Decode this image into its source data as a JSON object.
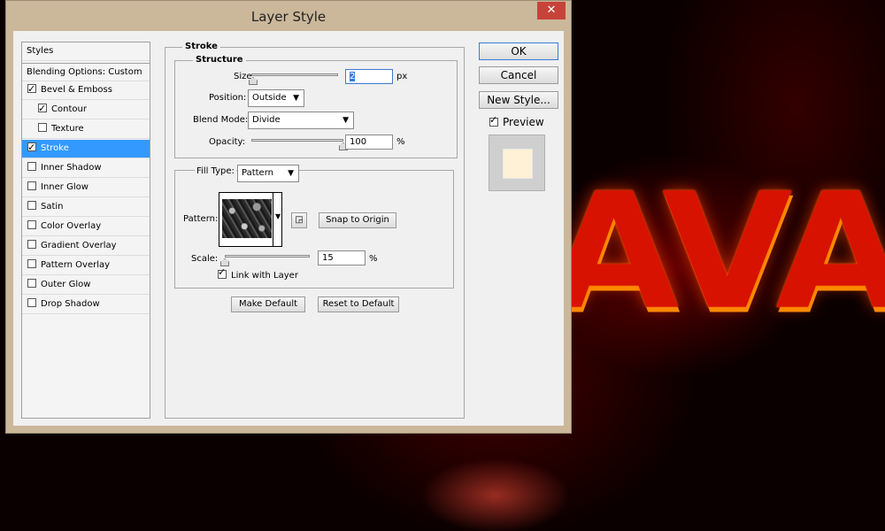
{
  "background": {
    "artwork_text": "AVA"
  },
  "dialog": {
    "title": "Layer Style",
    "close_label": "✕"
  },
  "styles_panel": {
    "header": "Styles",
    "blending_options": "Blending Options: Custom",
    "items": [
      {
        "label": "Bevel & Emboss",
        "checked": true,
        "indent": false
      },
      {
        "label": "Contour",
        "checked": true,
        "indent": true
      },
      {
        "label": "Texture",
        "checked": false,
        "indent": true
      },
      {
        "label": "Stroke",
        "checked": true,
        "indent": false,
        "selected": true
      },
      {
        "label": "Inner Shadow",
        "checked": false,
        "indent": false
      },
      {
        "label": "Inner Glow",
        "checked": false,
        "indent": false
      },
      {
        "label": "Satin",
        "checked": false,
        "indent": false
      },
      {
        "label": "Color Overlay",
        "checked": false,
        "indent": false
      },
      {
        "label": "Gradient Overlay",
        "checked": false,
        "indent": false
      },
      {
        "label": "Pattern Overlay",
        "checked": false,
        "indent": false
      },
      {
        "label": "Outer Glow",
        "checked": false,
        "indent": false
      },
      {
        "label": "Drop Shadow",
        "checked": false,
        "indent": false
      }
    ]
  },
  "stroke": {
    "section_title": "Stroke",
    "structure_title": "Structure",
    "size_label": "Size:",
    "size_value": "2",
    "size_unit": "px",
    "position_label": "Position:",
    "position_value": "Outside",
    "blend_mode_label": "Blend Mode:",
    "blend_mode_value": "Divide",
    "opacity_label": "Opacity:",
    "opacity_value": "100",
    "opacity_unit": "%",
    "opacity_level": 1.0,
    "size_level": 0.02,
    "fill_type_label": "Fill Type:",
    "fill_type_value": "Pattern",
    "pattern_label": "Pattern:",
    "snap_button": "Snap to Origin",
    "scale_label": "Scale:",
    "scale_value": "15",
    "scale_unit": "%",
    "scale_level": 0.0,
    "link_label": "Link with Layer",
    "link_checked": true,
    "make_default": "Make Default",
    "reset_default": "Reset to Default"
  },
  "right_panel": {
    "ok": "OK",
    "cancel": "Cancel",
    "new_style": "New Style...",
    "preview_label": "Preview",
    "preview_checked": true,
    "preview_color": "#fff1d6"
  },
  "colors": {
    "selection": "#3399ff",
    "dialog_frame": "#cbb79a",
    "close_button": "#c7433a",
    "lava": "#d81200"
  }
}
